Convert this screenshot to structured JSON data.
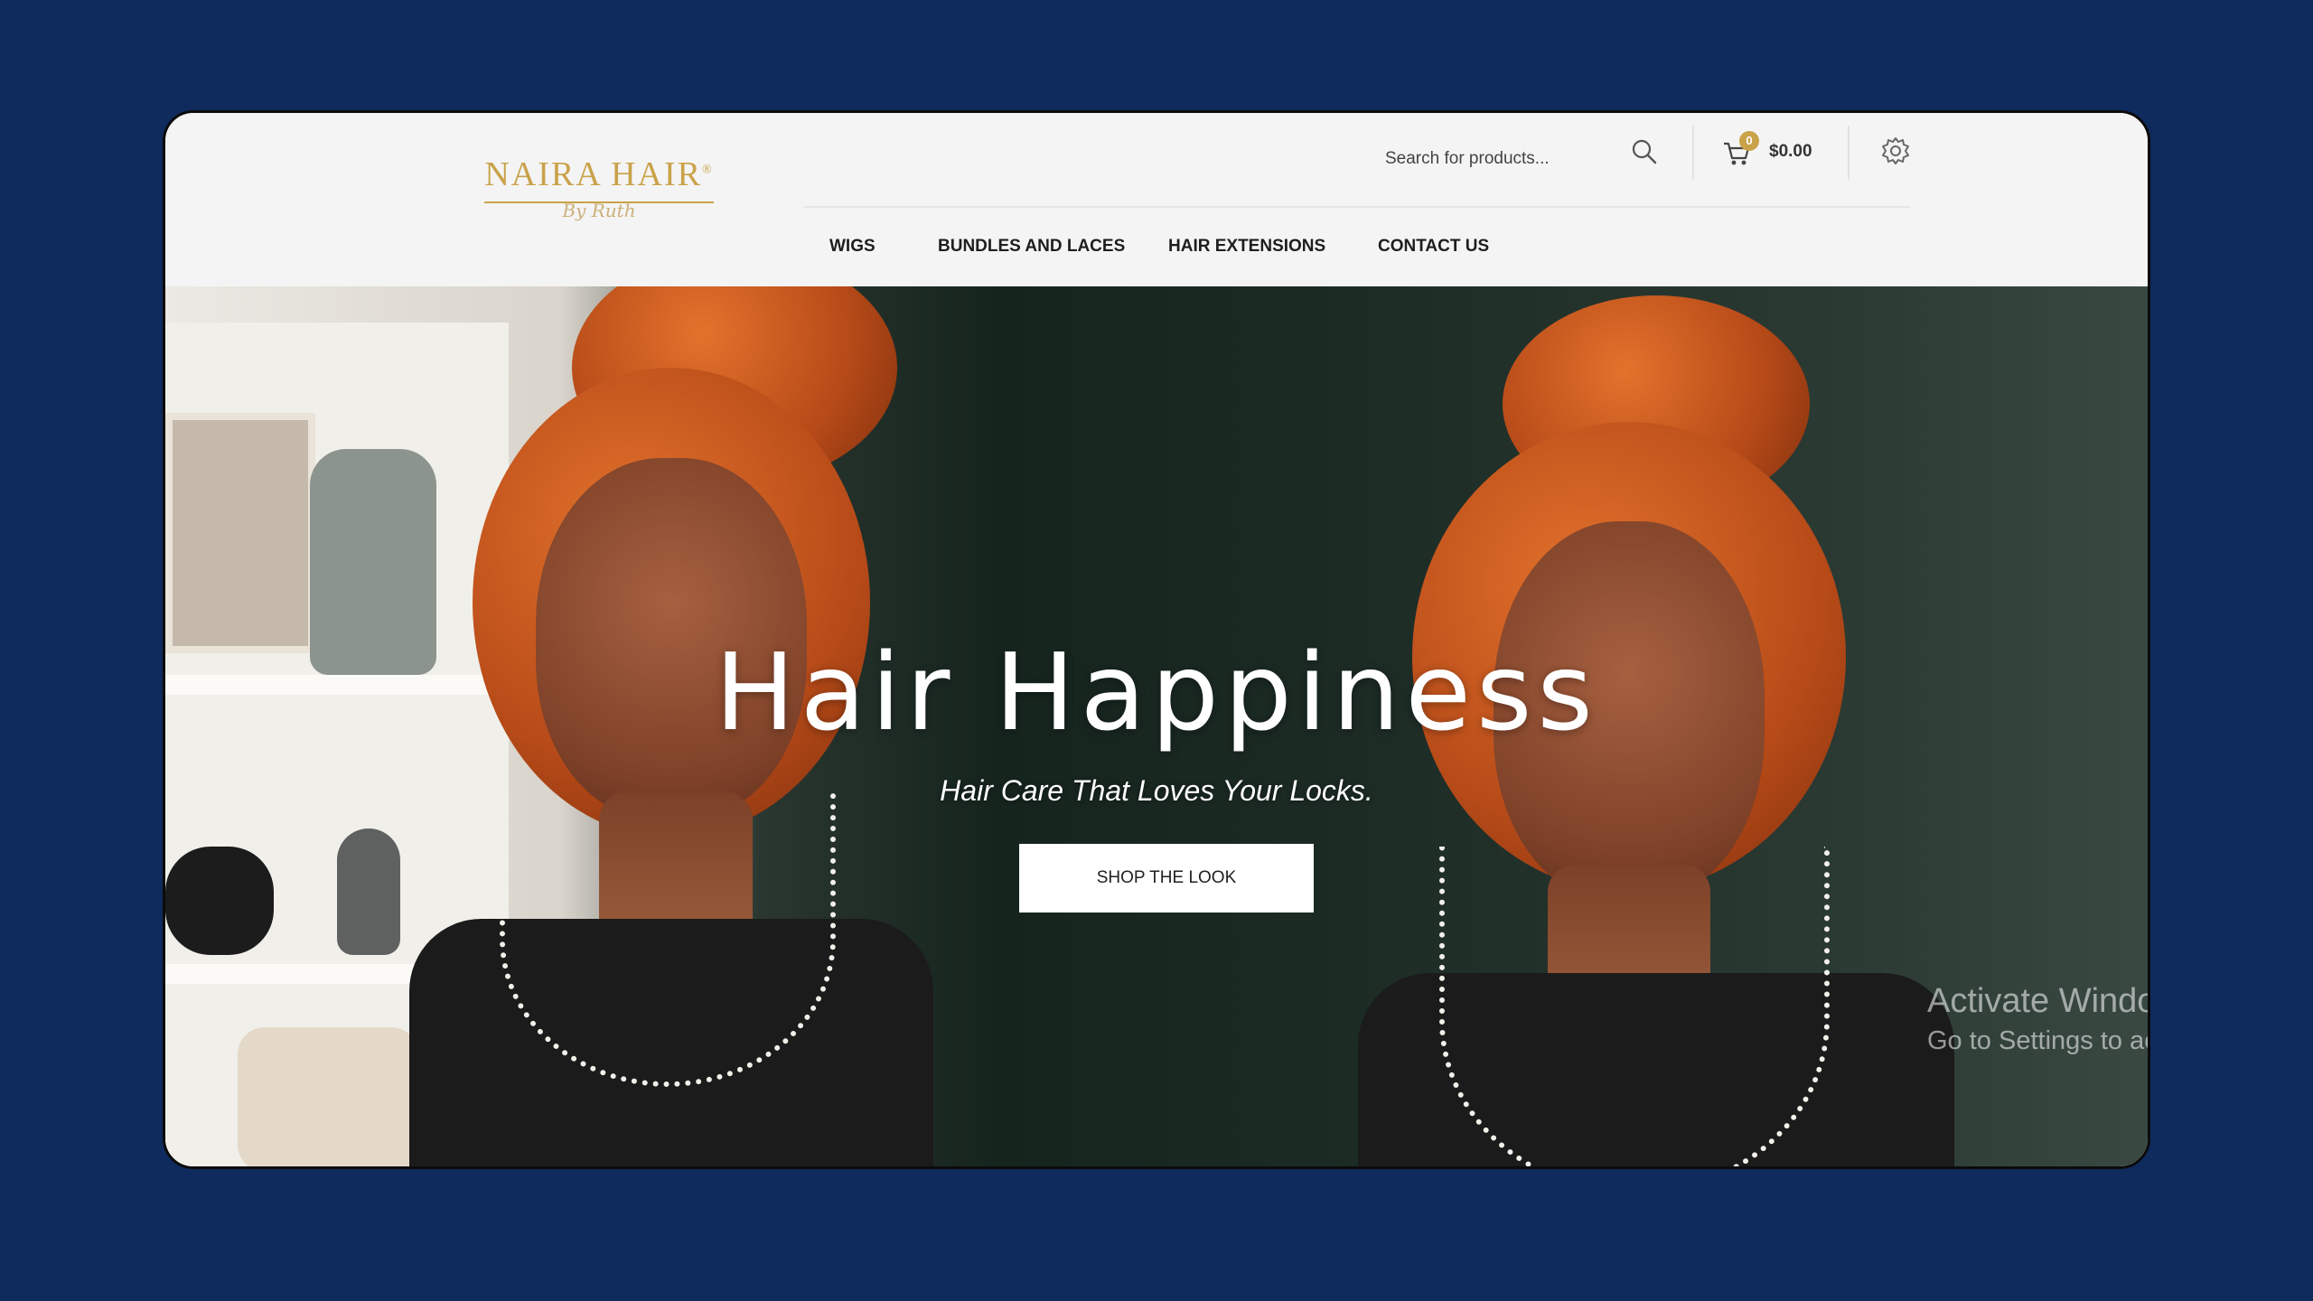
{
  "brand": {
    "logo_text": "NAIRA HAIR",
    "logo_mark": "®",
    "logo_script": "By Ruth"
  },
  "header": {
    "search": {
      "placeholder": "Search for products...",
      "icon": "search-icon"
    },
    "cart": {
      "count": "0",
      "total": "$0.00",
      "icon": "cart-icon"
    },
    "settings": {
      "icon": "gear-icon"
    }
  },
  "nav": {
    "items": [
      "WIGS",
      "BUNDLES AND LACES",
      "HAIR EXTENSIONS",
      "CONTACT US"
    ]
  },
  "hero": {
    "title": "Hair Happiness",
    "subtitle": "Hair Care That Loves Your Locks.",
    "cta": "SHOP THE LOOK"
  },
  "watermark": {
    "line1": "Activate Windows",
    "line2": "Go to Settings to activate Windows."
  },
  "colors": {
    "background": "#0f2a5c",
    "accent_gold": "#c9a24a",
    "header_bg": "#f4f4f4"
  }
}
